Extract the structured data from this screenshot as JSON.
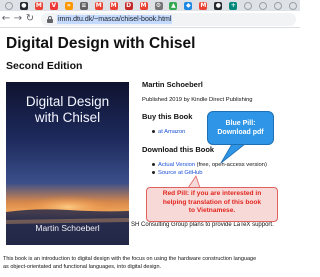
{
  "browser": {
    "tabs": [
      {
        "icon": "page-tab-icon",
        "color": "#9aa0a6",
        "glyph": ""
      },
      {
        "icon": "github-tab-icon",
        "color": "#24292e",
        "glyph": "●"
      },
      {
        "icon": "gmail-tab-icon",
        "color": "#ea4335",
        "glyph": "M"
      },
      {
        "icon": "vivaldi-tab-icon",
        "color": "#ef3939",
        "glyph": "V"
      },
      {
        "icon": "arrow-tab-icon",
        "color": "#ff9800",
        "glyph": "»"
      },
      {
        "icon": "doc-tab-icon",
        "color": "#616161",
        "glyph": "≡"
      },
      {
        "icon": "gmail-tab-icon",
        "color": "#ea4335",
        "glyph": "M"
      },
      {
        "icon": "gmail-tab-icon",
        "color": "#ea4335",
        "glyph": "M"
      },
      {
        "icon": "dtu-tab-icon",
        "color": "#c62828",
        "glyph": "D"
      },
      {
        "icon": "gmail-tab-icon",
        "color": "#ea4335",
        "glyph": "M"
      },
      {
        "icon": "tool-tab-icon",
        "color": "#757575",
        "glyph": "⚙"
      },
      {
        "icon": "drive-tab-icon",
        "color": "#34a853",
        "glyph": "▲"
      },
      {
        "icon": "chat-tab-icon",
        "color": "#1e88e5",
        "glyph": "◆"
      },
      {
        "icon": "gmail-tab-icon",
        "color": "#ea4335",
        "glyph": "M"
      },
      {
        "icon": "github-tab-icon",
        "color": "#24292e",
        "glyph": "●"
      },
      {
        "icon": "plus-tab-icon",
        "color": "#00897b",
        "glyph": "+"
      },
      {
        "icon": "page-tab-icon",
        "color": "#9aa0a6",
        "glyph": ""
      },
      {
        "icon": "page-tab-icon",
        "color": "#9aa0a6",
        "glyph": ""
      },
      {
        "icon": "page-tab-icon",
        "color": "#9aa0a6",
        "glyph": ""
      },
      {
        "icon": "page-tab-icon",
        "color": "#9aa0a6",
        "glyph": ""
      }
    ],
    "nav": {
      "back": "←",
      "forward": "→",
      "reload": "↻"
    },
    "url": "imm.dtu.dk/~masca/chisel-book.html"
  },
  "page": {
    "title": "Digital Design with Chisel",
    "edition": "Second Edition",
    "cover": {
      "title_line1": "Digital Design",
      "title_line2": "with Chisel",
      "author": "Martin Schoeberl"
    },
    "author": "Martin Schoeberl",
    "published": "Published 2019 by Kindle Direct Publishing",
    "buy": {
      "heading": "Buy this Book",
      "link": "at Amazon"
    },
    "download": {
      "heading": "Download this Book",
      "actual_version_link": "Actual Version",
      "actual_version_note": " (free, open-access version)",
      "github_link": "Source at GitHub"
    },
    "sh_note": "SH Consulting Group plans to provide LaTeX support.",
    "intro": "This book is an introduction to digital design with the focus on using the hardware construction language Chisel. Chisel brings advances from software engineering, such as object-orientated and functional languages, into digital design.",
    "intro_line1": "This book is an introduction to digital design with the focus on using the hardware construction language",
    "intro_line2": "as object-orientated and functional languages, into digital design."
  },
  "annotations": {
    "blue_line1": "Blue Pill:",
    "blue_line2": "Download pdf",
    "red_line1": "Red Pill: if you are interested in",
    "red_line2": "helping translation of this book",
    "red_line3": "to Vietnamese.",
    "blue_color": "#2f95e6",
    "red_color": "#e0261e"
  }
}
